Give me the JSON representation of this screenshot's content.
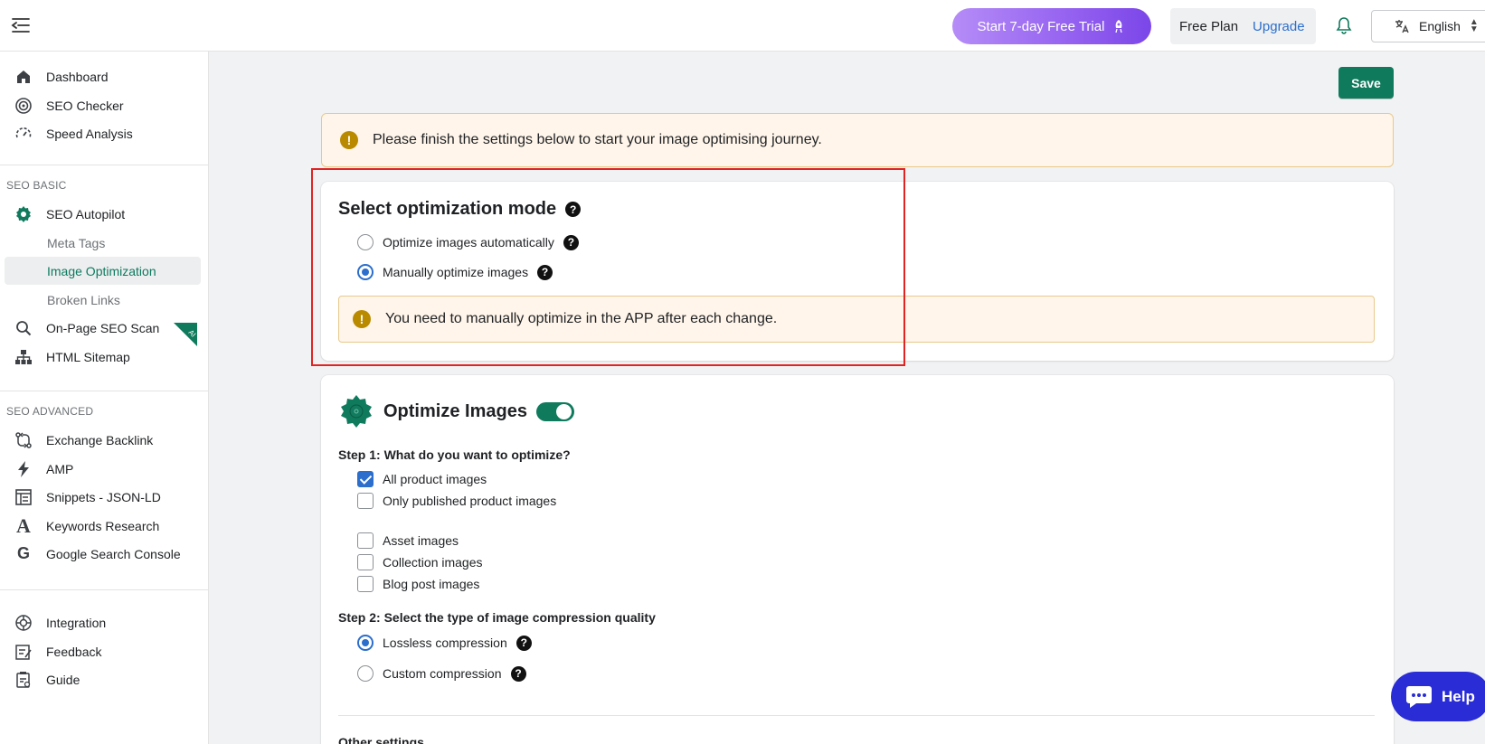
{
  "topbar": {
    "trial_label": "Start 7-day Free Trial",
    "plan_name": "Free Plan",
    "upgrade_label": "Upgrade",
    "language": "English"
  },
  "sidebar": {
    "items_top": [
      {
        "label": "Dashboard",
        "icon": "home-icon"
      },
      {
        "label": "SEO Checker",
        "icon": "target-icon"
      },
      {
        "label": "Speed Analysis",
        "icon": "speedometer-icon"
      }
    ],
    "section_basic": "SEO BASIC",
    "basic_items": [
      {
        "label": "SEO Autopilot",
        "icon": "gear-icon"
      },
      {
        "label": "Meta Tags"
      },
      {
        "label": "Image Optimization"
      },
      {
        "label": "Broken Links"
      },
      {
        "label": "On-Page SEO Scan",
        "icon": "search-icon"
      },
      {
        "label": "HTML Sitemap",
        "icon": "sitemap-icon"
      }
    ],
    "ai_badge": "AI",
    "section_advanced": "SEO ADVANCED",
    "advanced_items": [
      {
        "label": "Exchange Backlink",
        "icon": "exchange-icon"
      },
      {
        "label": "AMP",
        "icon": "lightning-icon"
      },
      {
        "label": "Snippets - JSON-LD",
        "icon": "snippet-icon"
      },
      {
        "label": "Keywords Research",
        "icon": "letter-a-icon"
      },
      {
        "label": "Google Search Console",
        "icon": "google-icon"
      }
    ],
    "bottom_items": [
      {
        "label": "Integration",
        "icon": "integration-icon"
      },
      {
        "label": "Feedback",
        "icon": "feedback-icon"
      },
      {
        "label": "Guide",
        "icon": "guide-icon"
      }
    ]
  },
  "main": {
    "save_label": "Save",
    "banner_text": "Please finish the settings below to start your image optimising journey.",
    "mode_card": {
      "title": "Select optimization mode",
      "options": [
        "Optimize images automatically",
        "Manually optimize images"
      ],
      "selected": 1,
      "warning": "You need to manually optimize in the APP after each change."
    },
    "optimize_card": {
      "title": "Optimize Images",
      "toggle_on": true,
      "step1_label": "Step 1: What do you want to optimize?",
      "step1_options": [
        {
          "label": "All product images",
          "checked": true
        },
        {
          "label": "Only published product images",
          "checked": false
        },
        {
          "label": "Asset images",
          "checked": false
        },
        {
          "label": "Collection images",
          "checked": false
        },
        {
          "label": "Blog post images",
          "checked": false
        }
      ],
      "step2_label": "Step 2: Select the type of image compression quality",
      "step2_options": [
        "Lossless compression",
        "Custom compression"
      ],
      "step2_selected": 0,
      "other_settings": "Other settings"
    }
  },
  "help": {
    "label": "Help"
  },
  "colors": {
    "accent_green": "#0f7a5c",
    "link_blue": "#2c6ecb",
    "trial_purple": "#9461f0",
    "help_blue": "#2a2cd6"
  }
}
